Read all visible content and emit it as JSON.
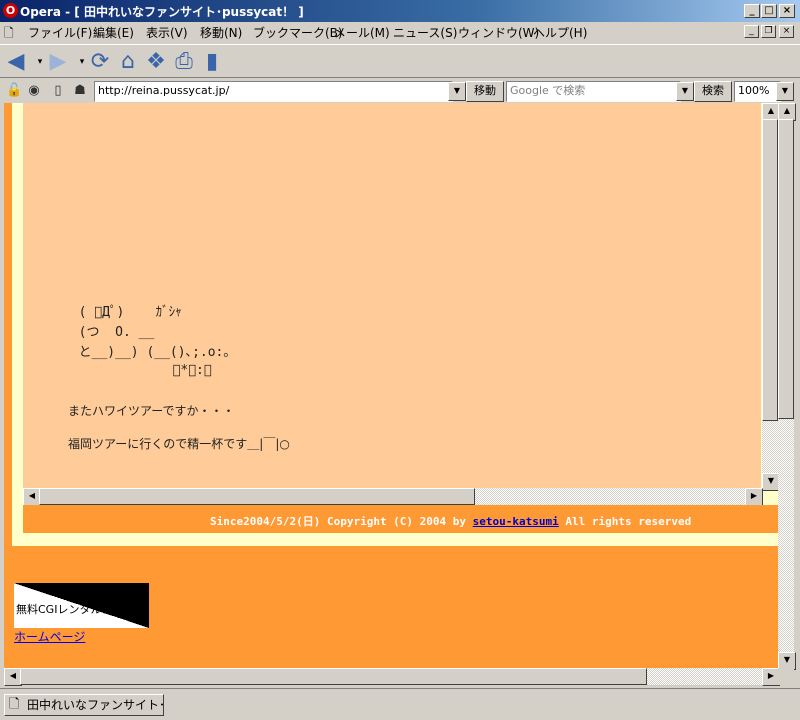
{
  "window": {
    "title": "Opera - [ 田中れいなファンサイト･pussycat！ ]",
    "controls": {
      "minimize": "_",
      "maximize": "□",
      "close": "×"
    },
    "mdi_controls": {
      "minimize": "_",
      "restore": "❐",
      "close": "×"
    }
  },
  "menu": [
    {
      "label": "ファイル(F)"
    },
    {
      "label": "編集(E)"
    },
    {
      "label": "表示(V)"
    },
    {
      "label": "移動(N)"
    },
    {
      "label": "ブックマーク(B)"
    },
    {
      "label": "メール(M)"
    },
    {
      "label": "ニュース(S)"
    },
    {
      "label": "ウィンドウ(W)"
    },
    {
      "label": "ヘルプ(H)"
    }
  ],
  "toolbar": {
    "icons": [
      "back-icon",
      "forward-icon",
      "reload-icon",
      "home-icon",
      "hotlist-icon",
      "print-icon",
      "page-icon"
    ]
  },
  "address_bar": {
    "url": "http://reina.pussycat.jp/",
    "go_label": "移動",
    "search_placeholder": "Google で検索",
    "search_label": "検索",
    "zoom": "100%"
  },
  "content": {
    "ascii_art": [
      "  ( ﾟДﾟ)    ｶﾞｼｬ",
      "  (つ  O. __",
      "  と__)__) (__()､;.o:｡",
      "              ﾟ*･:｡"
    ],
    "line1": "またハワイツアーですか・・・",
    "line2": "福岡ツアーに行くので精一杯です＿|￣|○",
    "footer_prefix": "Since2004/5/2(日) Copyright (C) 2004 by ",
    "footer_link": "setou-katsumi",
    "footer_suffix": " All rights reserved",
    "banner_text": "無料CGIレンタル！",
    "home_link": "ホームページ"
  },
  "tab": {
    "label": "田中れいなファンサイト･..."
  }
}
